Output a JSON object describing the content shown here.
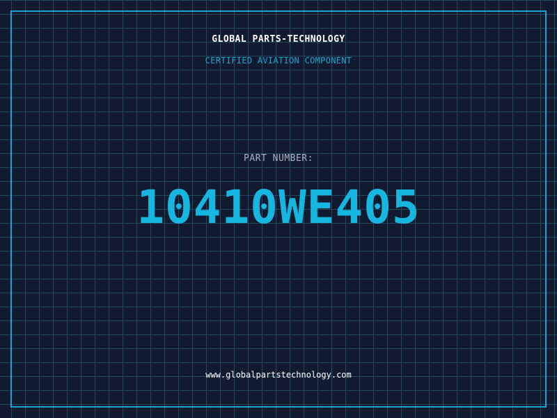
{
  "header": {
    "company": "GLOBAL PARTS-TECHNOLOGY",
    "subtitle": "CERTIFIED AVIATION COMPONENT"
  },
  "part": {
    "label": "PART NUMBER:",
    "number": "10410WE405"
  },
  "footer": {
    "website": "www.globalpartstechnology.com"
  },
  "colors": {
    "background": "#111a2e",
    "grid": "#1f4a60",
    "frame": "#1ea3c9",
    "accent": "#17b6e0"
  }
}
